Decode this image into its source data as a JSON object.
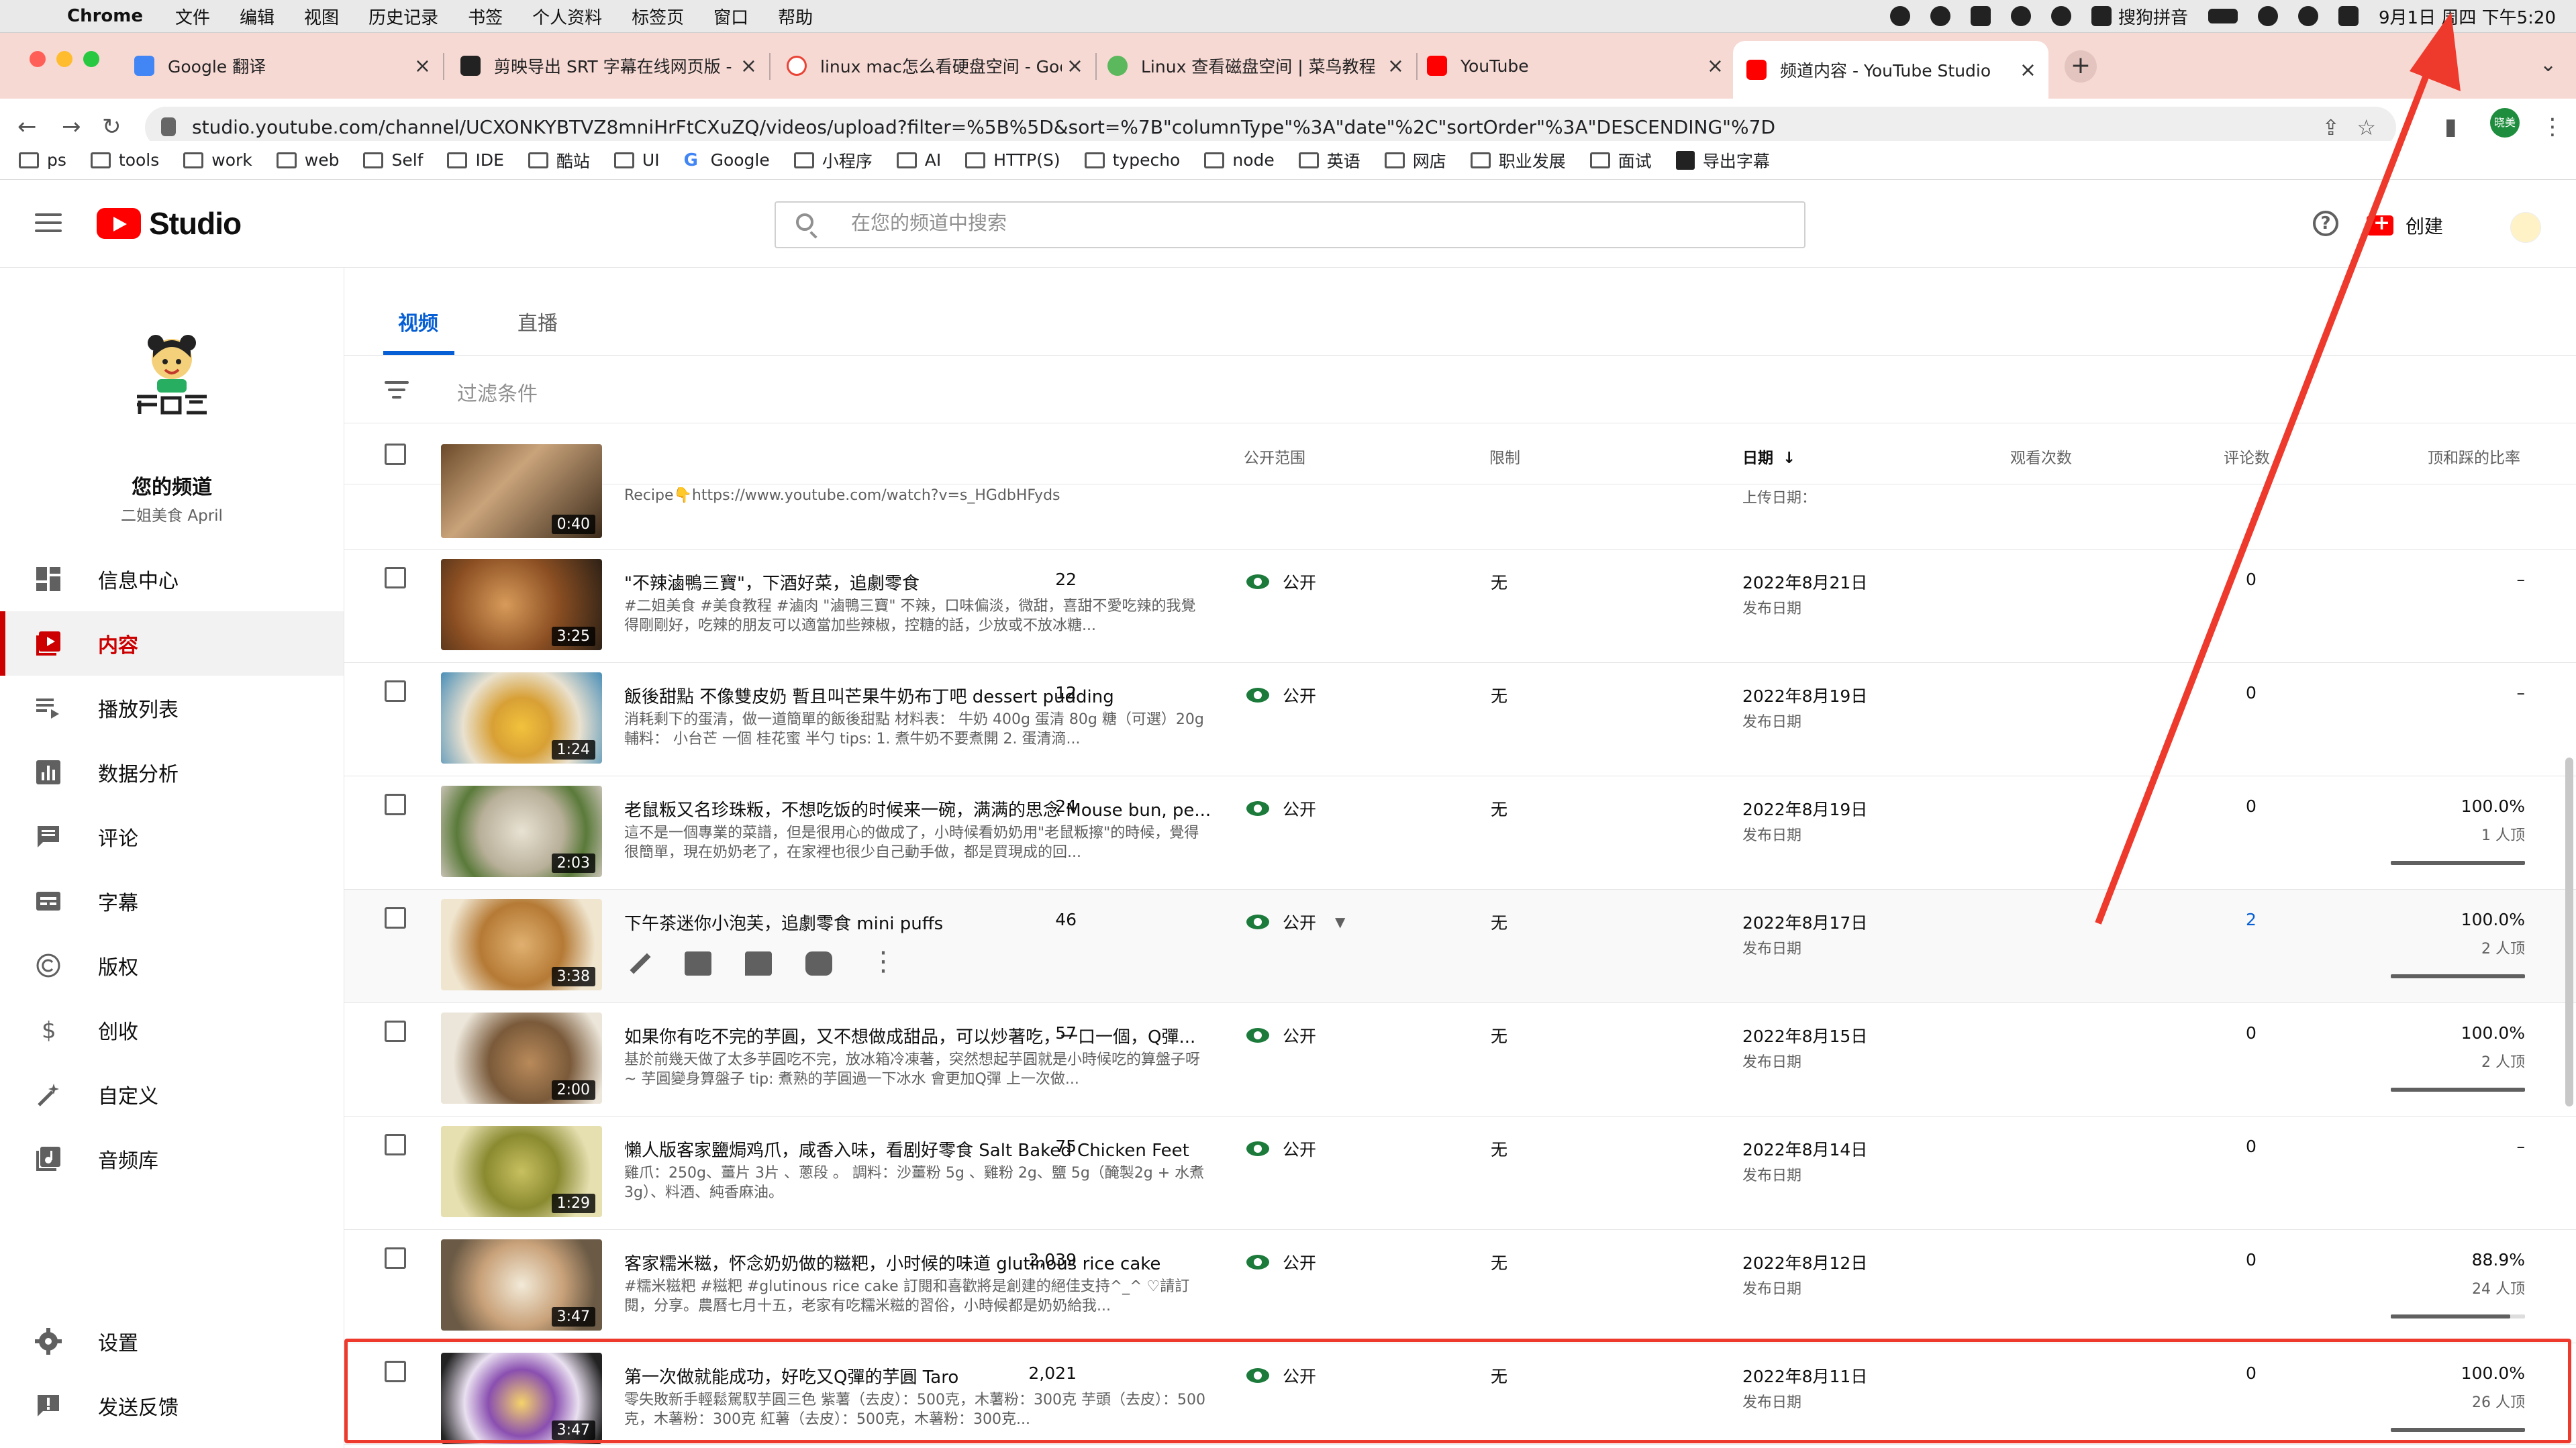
{
  "menubar": {
    "app": "Chrome",
    "items": [
      "文件",
      "编辑",
      "视图",
      "历史记录",
      "书签",
      "个人资料",
      "标签页",
      "窗口",
      "帮助"
    ],
    "ime": "搜狗拼音",
    "clock": "9月1日 周四 下午5:20"
  },
  "tabs": [
    {
      "title": "Google 翻译"
    },
    {
      "title": "剪映导出 SRT 字幕在线网页版 -"
    },
    {
      "title": "linux mac怎么看硬盘空间 - Goo"
    },
    {
      "title": "Linux 查看磁盘空间 | 菜鸟教程"
    },
    {
      "title": "YouTube"
    },
    {
      "title": "频道内容 - YouTube Studio"
    }
  ],
  "address": {
    "url": "studio.youtube.com/channel/UCXONKYBTVZ8mniHrFtCXuZQ/videos/upload?filter=%5B%5D&sort=%7B\"columnType\"%3A\"date\"%2C\"sortOrder\"%3A\"DESCENDING\"%7D",
    "profile_label": "晓美"
  },
  "bookmarks": [
    "ps",
    "tools",
    "work",
    "web",
    "Self",
    "IDE",
    "酷站",
    "UI",
    "Google",
    "小程序",
    "AI",
    "HTTP(S)",
    "typecho",
    "node",
    "英语",
    "网店",
    "职业发展",
    "面试",
    "导出字幕"
  ],
  "header": {
    "brand": "Studio",
    "search_placeholder": "在您的频道中搜索",
    "create_label": "创建"
  },
  "sidebar": {
    "channel_title": "您的频道",
    "channel_name": "二姐美食 April",
    "items": [
      {
        "label": "信息中心"
      },
      {
        "label": "内容"
      },
      {
        "label": "播放列表"
      },
      {
        "label": "数据分析"
      },
      {
        "label": "评论"
      },
      {
        "label": "字幕"
      },
      {
        "label": "版权"
      },
      {
        "label": "创收"
      },
      {
        "label": "自定义"
      },
      {
        "label": "音频库"
      }
    ],
    "settings_label": "设置",
    "feedback_label": "发送反馈"
  },
  "content": {
    "tabs": [
      "视频",
      "直播"
    ],
    "filter_placeholder": "过滤条件",
    "columns": {
      "video": "视频",
      "visibility": "公开范围",
      "restrictions": "限制",
      "date": "日期",
      "views": "观看次数",
      "comments": "评论数",
      "like_ratio": "顶和踩的比率"
    },
    "partial_row": {
      "desc": "Recipe👇https://www.youtube.com/watch?v=s_HGdbHFyds",
      "duration": "0:40",
      "date_type": "上传日期："
    },
    "rows": [
      {
        "title": "\"不辣滷鴨三寶\"，下酒好菜，追劇零食",
        "desc": "#二姐美食 #美食教程 #滷肉 \"滷鴨三寶\" 不辣，口味偏淡，微甜，喜甜不愛吃辣的我覺得剛剛好，吃辣的朋友可以適當加些辣椒，控糖的話，少放或不放冰糖...",
        "duration": "3:25",
        "visibility": "公开",
        "restriction": "无",
        "date": "2022年8月21日",
        "date_type": "发布日期",
        "views": "22",
        "comments": "0",
        "ratio": "–",
        "votes": "",
        "ratio_fill": 0
      },
      {
        "title": "飯後甜點 不像雙皮奶 暫且叫芒果牛奶布丁吧 dessert pudding",
        "desc": "消耗剩下的蛋清，做一道簡單的飯後甜點 材料表： 牛奶 400g 蛋清 80g 糖（可選）20g 輔料： 小台芒 一個 桂花蜜 半勺 tips: 1. 煮牛奶不要煮開 2. 蛋清滴...",
        "duration": "1:24",
        "visibility": "公开",
        "restriction": "无",
        "date": "2022年8月19日",
        "date_type": "发布日期",
        "views": "12",
        "comments": "0",
        "ratio": "–",
        "votes": "",
        "ratio_fill": 0
      },
      {
        "title": "老鼠粄又名珍珠粄，不想吃饭的时候来一碗，满满的思念 Mouse bun, pe...",
        "desc": "這不是一個專業的菜譜，但是很用心的做成了，小時候看奶奶用\"老鼠粄擦\"的時候，覺得很簡單，現在奶奶老了，在家裡也很少自己動手做，都是買現成的回...",
        "duration": "2:03",
        "visibility": "公开",
        "restriction": "无",
        "date": "2022年8月19日",
        "date_type": "发布日期",
        "views": "24",
        "comments": "0",
        "ratio": "100.0%",
        "votes": "1 人顶",
        "ratio_fill": 1.0
      },
      {
        "title": "下午茶迷你小泡芙，追劇零食 mini puffs",
        "desc": "",
        "duration": "3:38",
        "visibility": "公开",
        "restriction": "无",
        "date": "2022年8月17日",
        "date_type": "发布日期",
        "views": "46",
        "comments": "2",
        "ratio": "100.0%",
        "votes": "2 人顶",
        "ratio_fill": 1.0
      },
      {
        "title": "如果你有吃不完的芋圓，又不想做成甜品，可以炒著吃，一口一個，Q彈...",
        "desc": "基於前幾天做了太多芋圓吃不完，放冰箱冷凍著，突然想起芋圓就是小時候吃的算盤子呀~ 芋圓變身算盤子 tip: 煮熟的芋圓過一下冰水 會更加Q彈 上一次做...",
        "duration": "2:00",
        "visibility": "公开",
        "restriction": "无",
        "date": "2022年8月15日",
        "date_type": "发布日期",
        "views": "57",
        "comments": "0",
        "ratio": "100.0%",
        "votes": "2 人顶",
        "ratio_fill": 1.0
      },
      {
        "title": "懶人版客家鹽焗鸡爪，咸香入味，看剧好零食 Salt Baked Chicken Feet",
        "desc": "雞爪：250g、薑片 3片 、蔥段 。 調料：沙薑粉 5g 、雞粉 2g、鹽 5g（醃製2g + 水煮3g）、料酒、純香麻油。",
        "duration": "1:29",
        "visibility": "公开",
        "restriction": "无",
        "date": "2022年8月14日",
        "date_type": "发布日期",
        "views": "75",
        "comments": "0",
        "ratio": "–",
        "votes": "",
        "ratio_fill": 0
      },
      {
        "title": "客家糯米糍，怀念奶奶做的糍粑，小时候的味道 glutinous rice cake",
        "desc": "#糯米糍粑 #糍粑 #glutinous rice cake 訂閱和喜歡將是創建的絕佳支持^_^ ♡請訂閱，分享。農曆七月十五，老家有吃糯米糍的習俗，小時候都是奶奶給我...",
        "duration": "3:47",
        "visibility": "公开",
        "restriction": "无",
        "date": "2022年8月12日",
        "date_type": "发布日期",
        "views": "2,039",
        "comments": "0",
        "ratio": "88.9%",
        "votes": "24 人顶",
        "ratio_fill": 0.889
      },
      {
        "title": "第一次做就能成功，好吃又Q彈的芋圓 Taro",
        "desc": "零失敗新手輕鬆駕馭芋圓三色 紫薯（去皮）：500克，木薯粉：300克 芋頭（去皮）：500克，木薯粉：300克 紅薯（去皮）：500克，木薯粉：300克...",
        "duration": "3:47",
        "visibility": "公开",
        "restriction": "无",
        "date": "2022年8月11日",
        "date_type": "发布日期",
        "views": "2,021",
        "comments": "0",
        "ratio": "100.0%",
        "votes": "26 人顶",
        "ratio_fill": 1.0
      }
    ]
  },
  "colors": {
    "accent_red": "#cc0000",
    "link_blue": "#065fd4",
    "annotation_red": "#ee3a2c",
    "public_green": "#1c7a3b"
  }
}
